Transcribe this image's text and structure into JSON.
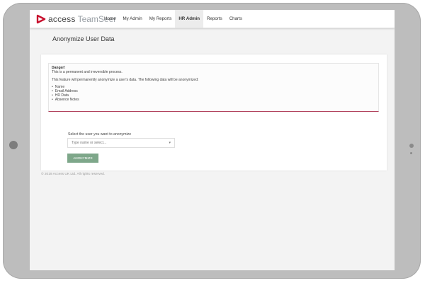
{
  "app": {
    "logo_text_primary": "access",
    "logo_text_secondary": "TeamSeer"
  },
  "nav": {
    "items": [
      {
        "label": "Home"
      },
      {
        "label": "My Admin"
      },
      {
        "label": "My Reports"
      },
      {
        "label": "HR Admin"
      },
      {
        "label": "Reports"
      },
      {
        "label": "Charts"
      }
    ]
  },
  "page": {
    "title": "Anonymize User Data"
  },
  "alert": {
    "heading": "Danger!",
    "line1": "This is a permanent and irreversible process.",
    "line2": "This feature will permanently anonymize a user's data. The following data will be anonymized:",
    "items": [
      "Name",
      "Email Address",
      "HR Data",
      "Absence Notes"
    ]
  },
  "form": {
    "select_label": "Select the user you want to anonymize",
    "select_placeholder": "Type name or select...",
    "button_label": "ANONYMIZE"
  },
  "footer": {
    "text": "© 2019 Access UK Ltd. All rights reserved."
  },
  "colors": {
    "button": "#7ea78a",
    "alert_border": "#b0405a",
    "logo_mark": "#c8102e"
  }
}
